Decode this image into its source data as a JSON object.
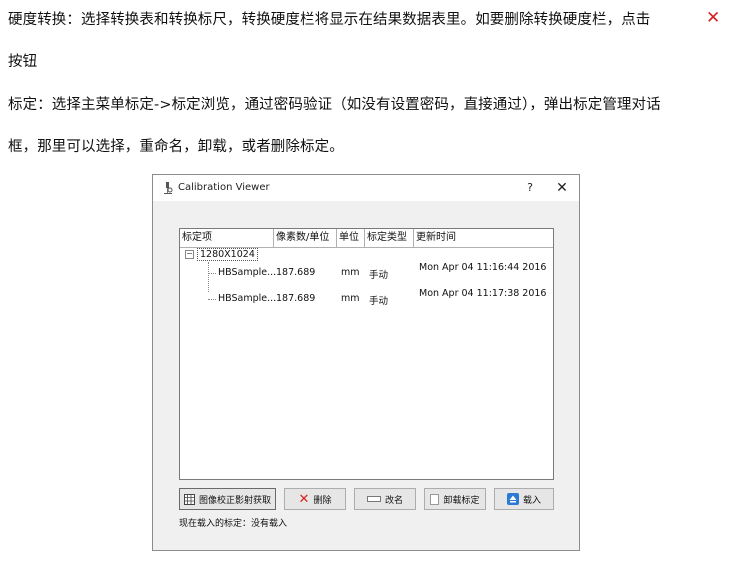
{
  "doc": {
    "line1": "硬度转换：选择转换表和转换标尺，转换硬度栏将显示在结果数据表里。如要删除转换硬度栏，点击",
    "line2": "按钮",
    "line3": "标定：选择主菜单标定->标定浏览，通过密码验证（如没有设置密码，直接通过），弹出标定管理对话",
    "line4": "框，那里可以选择，重命名，卸载，或者删除标定。",
    "delete_icon": "red-x-icon"
  },
  "dialog": {
    "title": "Calibration Viewer",
    "help": "?",
    "close": "✕",
    "columns": [
      "标定项",
      "像素数/单位",
      "单位",
      "标定类型",
      "更新时间"
    ],
    "root": "1280X1024",
    "rows": [
      {
        "name": "HBSample...",
        "pixels": "187.689",
        "unit": "mm",
        "type": "手动",
        "time": "Mon Apr 04 11:16:44 2016"
      },
      {
        "name": "HBSample...",
        "pixels": "187.689",
        "unit": "mm",
        "type": "手动",
        "time": "Mon Apr 04 11:17:38 2016"
      }
    ],
    "buttons": {
      "correct": "图像校正影射获取",
      "delete": "删除",
      "rename": "改名",
      "unload": "卸载标定",
      "load": "载入"
    },
    "status": "现在载入的标定：没有载入"
  }
}
